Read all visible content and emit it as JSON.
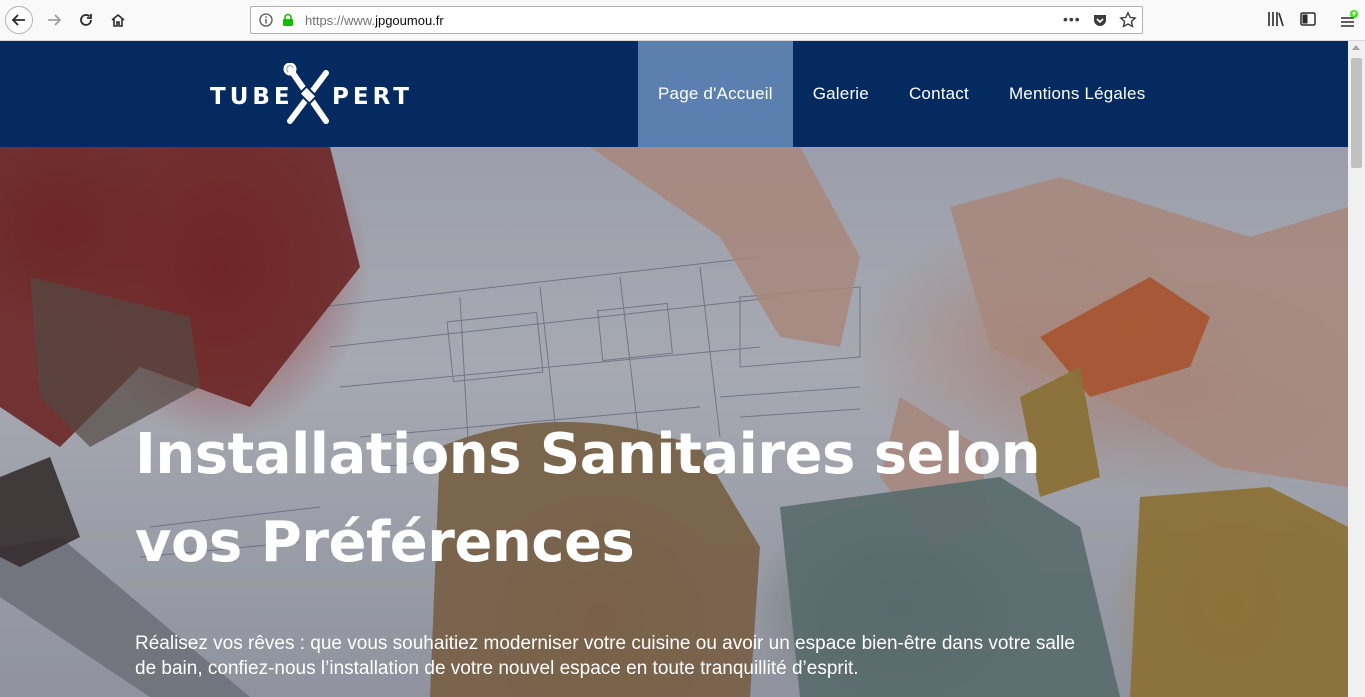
{
  "browser": {
    "url_prefix": "https://www.",
    "url_domain": "jpgoumou.fr",
    "page_actions": "•••"
  },
  "site": {
    "logo_left": "TUBE",
    "logo_right": "PERT",
    "brand_color": "#042a5f",
    "active_color": "#5b7fae"
  },
  "nav": {
    "items": [
      {
        "label": "Page d'Accueil"
      },
      {
        "label": "Galerie"
      },
      {
        "label": "Contact"
      },
      {
        "label": "Mentions Légales"
      }
    ]
  },
  "hero": {
    "title": "Installations Sanitaires selon vos Préférences",
    "text": "Réalisez vos rêves : que vous souhaitiez moderniser votre cuisine ou avoir un espace bien-être dans votre salle de bain, confiez-nous l’installation de votre nouvel espace en toute tranquillité d’esprit."
  }
}
